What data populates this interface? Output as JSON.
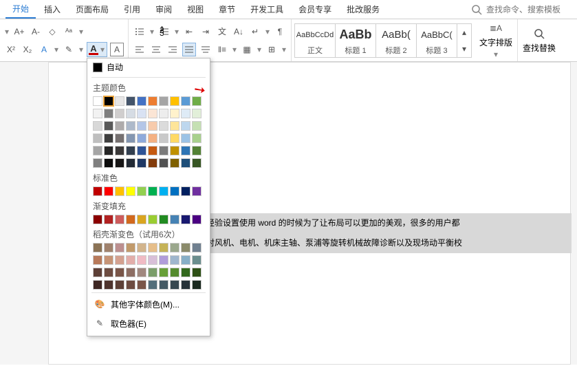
{
  "tabs": {
    "items": [
      "开始",
      "插入",
      "页面布局",
      "引用",
      "审阅",
      "视图",
      "章节",
      "开发工具",
      "会员专享",
      "批改服务"
    ],
    "active": 0
  },
  "search": {
    "placeholder": "查找命令、搜索模板"
  },
  "styles": {
    "items": [
      {
        "preview": "AaBbCcDd",
        "label": "正文",
        "bold": false,
        "size": "11px"
      },
      {
        "preview": "AaBb",
        "label": "标题 1",
        "bold": true,
        "size": "18px"
      },
      {
        "preview": "AaBb(",
        "label": "标题 2",
        "bold": false,
        "size": "15px"
      },
      {
        "preview": "AaBbC(",
        "label": "标题 3",
        "bold": false,
        "size": "13px"
      }
    ]
  },
  "side": {
    "wrap": "文字排版",
    "findrep": "查找替换"
  },
  "doc": {
    "line1": "经验设置使用 word 的时候为了让布局可以更加的美观，很多的用户都",
    "line2": "对风机、电机、机床主轴、泵浦等旋转机械故障诊断以及现场动平衡校"
  },
  "popup": {
    "auto": "自动",
    "theme_label": "主题颜色",
    "theme_top": [
      "#FFFFFF",
      "#000000",
      "#E7E6E6",
      "#44546A",
      "#4472C4",
      "#ED7D31",
      "#A5A5A5",
      "#FFC000",
      "#5B9BD5",
      "#70AD47"
    ],
    "theme_shades": [
      [
        "#F2F2F2",
        "#7F7F7F",
        "#D0CECE",
        "#D6DCE4",
        "#D9E2F3",
        "#FBE5D5",
        "#EDEDED",
        "#FFF2CC",
        "#DEEBF6",
        "#E2EFD9"
      ],
      [
        "#D8D8D8",
        "#595959",
        "#AEABAB",
        "#ADB9CA",
        "#B4C6E7",
        "#F7CBAC",
        "#DBDBDB",
        "#FEE599",
        "#BDD7EE",
        "#C5E0B3"
      ],
      [
        "#BFBFBF",
        "#3F3F3F",
        "#757070",
        "#8496B0",
        "#8EAADB",
        "#F4B183",
        "#C9C9C9",
        "#FFD965",
        "#9CC3E5",
        "#A8D08D"
      ],
      [
        "#A5A5A5",
        "#262626",
        "#3A3838",
        "#323F4F",
        "#2F5496",
        "#C55A11",
        "#7B7B7B",
        "#BF9000",
        "#2E75B5",
        "#538135"
      ],
      [
        "#7F7F7F",
        "#0C0C0C",
        "#171616",
        "#222A35",
        "#1F3864",
        "#833C0B",
        "#525252",
        "#7F6000",
        "#1E4E79",
        "#375623"
      ]
    ],
    "standard_label": "标准色",
    "standard": [
      "#C00000",
      "#FF0000",
      "#FFC000",
      "#FFFF00",
      "#92D050",
      "#00B050",
      "#00B0F0",
      "#0070C0",
      "#002060",
      "#7030A0"
    ],
    "gradient_label": "渐变填充",
    "gradient": [
      "#8B0000",
      "#B22222",
      "#CD5C5C",
      "#D2691E",
      "#DAA520",
      "#9ACD32",
      "#228B22",
      "#4682B4",
      "#191970",
      "#4B0082"
    ],
    "doc_label": "稻壳渐变色（试用6次）",
    "doc_colors": [
      [
        "#8B7355",
        "#A0826D",
        "#BC8F8F",
        "#C19A6B",
        "#D2B48C",
        "#E6BE8A",
        "#C5B358",
        "#9BA88D",
        "#8B8B6B",
        "#708090"
      ],
      [
        "#B87A5B",
        "#C69476",
        "#D4A190",
        "#E2AEAA",
        "#F0BBC4",
        "#D8BFD8",
        "#B19CD9",
        "#9FB6CD",
        "#87AFC7",
        "#6B8E8E"
      ],
      [
        "#5D4037",
        "#6D4C41",
        "#795548",
        "#8D6E63",
        "#A1887F",
        "#7B9E6B",
        "#689F38",
        "#558B2F",
        "#33691E",
        "#2E5016"
      ],
      [
        "#3E2723",
        "#4E342E",
        "#5D4037",
        "#6D4C41",
        "#795548",
        "#546E7A",
        "#455A64",
        "#37474F",
        "#263238",
        "#1B2A1F"
      ]
    ],
    "more": "其他字体颜色(M)...",
    "picker": "取色器(E)"
  }
}
